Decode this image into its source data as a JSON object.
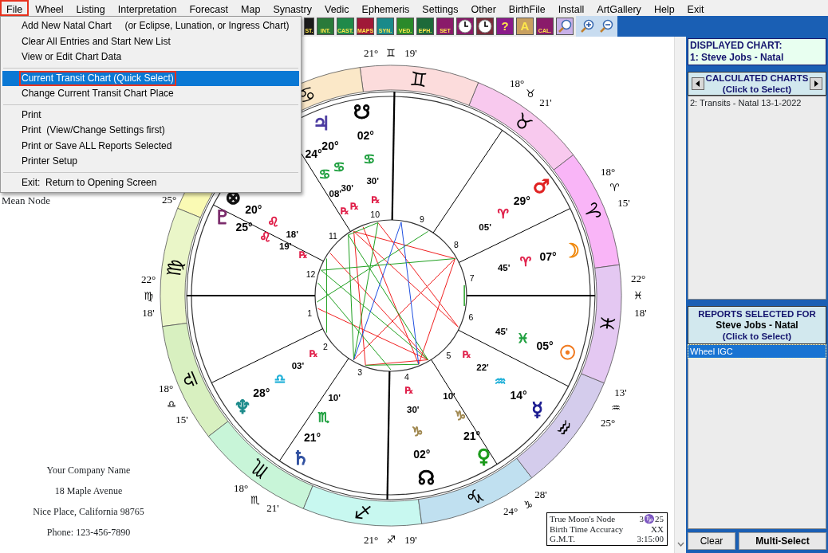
{
  "menu_bar": [
    {
      "label": "File",
      "outlined": true
    },
    {
      "label": "Wheel",
      "outlined": false
    },
    {
      "label": "Listing",
      "outlined": false
    },
    {
      "label": "Interpretation",
      "outlined": false
    },
    {
      "label": "Forecast",
      "outlined": false
    },
    {
      "label": "Map",
      "outlined": false
    },
    {
      "label": "Synastry",
      "outlined": false
    },
    {
      "label": "Vedic",
      "outlined": false
    },
    {
      "label": "Ephemeris",
      "outlined": false
    },
    {
      "label": "Settings",
      "outlined": false
    },
    {
      "label": "Other",
      "outlined": false
    },
    {
      "label": "BirthFile",
      "outlined": false
    },
    {
      "label": "Install",
      "outlined": false
    },
    {
      "label": "ArtGallery",
      "outlined": false
    },
    {
      "label": "Help",
      "outlined": false
    },
    {
      "label": "Exit",
      "outlined": false
    }
  ],
  "file_menu": [
    {
      "kind": "item",
      "label": "Add New Natal Chart     (or Eclipse, Lunation, or Ingress Chart)",
      "selected": false,
      "outlined": false
    },
    {
      "kind": "item",
      "label": "Clear All Entries and Start New List",
      "selected": false,
      "outlined": false
    },
    {
      "kind": "item",
      "label": "View or Edit Chart Data",
      "selected": false,
      "outlined": false
    },
    {
      "kind": "separator"
    },
    {
      "kind": "item",
      "label": "Current Transit Chart (Quick Select)",
      "selected": true,
      "outlined": true
    },
    {
      "kind": "item",
      "label": "Change Current Transit Chart Place",
      "selected": false,
      "outlined": false
    },
    {
      "kind": "separator"
    },
    {
      "kind": "item",
      "label": "Print",
      "selected": false,
      "outlined": false
    },
    {
      "kind": "item",
      "label": "Print  (View/Change Settings first)",
      "selected": false,
      "outlined": false
    },
    {
      "kind": "item",
      "label": "Print or Save ALL Reports Selected",
      "selected": false,
      "outlined": false
    },
    {
      "kind": "item",
      "label": "Printer Setup",
      "selected": false,
      "outlined": false
    },
    {
      "kind": "separator"
    },
    {
      "kind": "item",
      "label": "Exit:  Return to Opening Screen",
      "selected": false,
      "outlined": false
    }
  ],
  "toolbar": [
    {
      "kind": "labeled",
      "label": "ST.",
      "color": "#1a1a1a"
    },
    {
      "kind": "labeled",
      "label": "INT.",
      "color": "#2a7a3a"
    },
    {
      "kind": "labeled",
      "label": "CAST.",
      "color": "#1f8a4a"
    },
    {
      "kind": "labeled",
      "label": "MAPS",
      "color": "#a01838"
    },
    {
      "kind": "labeled",
      "label": "SYN.",
      "color": "#1a8a8a"
    },
    {
      "kind": "labeled",
      "label": "VED.",
      "color": "#2a8a2a"
    },
    {
      "kind": "labeled",
      "label": "EPH.",
      "color": "#1d6a3a"
    },
    {
      "kind": "labeled",
      "label": "SET",
      "color": "#8a1a6a"
    },
    {
      "kind": "clock",
      "color": "#8a1a6a"
    },
    {
      "kind": "clock",
      "color": "#7a2a3a"
    },
    {
      "kind": "help",
      "label": "?",
      "color": "#8a1a8a"
    },
    {
      "kind": "help",
      "label": "A",
      "color": "#c8a060"
    },
    {
      "kind": "labeled",
      "label": "CAL.",
      "color": "#8a1a6a"
    },
    {
      "kind": "magnifier",
      "color": "#c8b0e8"
    },
    {
      "kind": "zoom-in",
      "color": "#c8dcf0"
    },
    {
      "kind": "zoom-out",
      "color": "#c8dcf0"
    }
  ],
  "chart": {
    "side_label": "Mean Node",
    "zodiac_ring": [
      {
        "glyph": "♈",
        "color": "#f9b5f7"
      },
      {
        "glyph": "♉",
        "color": "#f8c9ee"
      },
      {
        "glyph": "♊",
        "color": "#fcdcdc"
      },
      {
        "glyph": "♋",
        "color": "#fbe8c8"
      },
      {
        "color": "#fafab4"
      },
      {
        "glyph": "♍",
        "color": "#eaf6c8"
      },
      {
        "glyph": "♎",
        "color": "#d8f0c0"
      },
      {
        "glyph": "♏",
        "color": "#c8f5d8"
      },
      {
        "glyph": "♐",
        "color": "#c8f8f0"
      },
      {
        "glyph": "♑",
        "color": "#c0e0f0"
      },
      {
        "glyph": "♒",
        "color": "#d4ccec"
      },
      {
        "glyph": "♓",
        "color": "#e4c8f2"
      }
    ],
    "cusps": [
      {
        "degree": "22°",
        "sign": "♍",
        "minutes": "18'"
      },
      {
        "degree": "18°",
        "sign": "♎",
        "minutes": "15'"
      },
      {
        "degree": "18°",
        "sign": "♏",
        "minutes": "21'"
      },
      {
        "degree": "21°",
        "sign": "♐",
        "minutes": "19'"
      },
      {
        "degree": "24°",
        "sign": "♑",
        "minutes": "28'"
      },
      {
        "degree": "25°",
        "sign": "♒",
        "minutes": "13'"
      },
      {
        "degree": "22°",
        "sign": "♓",
        "minutes": "18'"
      },
      {
        "degree": "18°",
        "sign": "♈",
        "minutes": "15'"
      },
      {
        "degree": "18°",
        "sign": "♉",
        "minutes": "21'"
      },
      {
        "degree": "21°",
        "sign": "♊",
        "minutes": "19'"
      },
      {
        "degree": "25°"
      }
    ],
    "house_numbers": [
      "1",
      "2",
      "3",
      "4",
      "5",
      "6",
      "7",
      "8",
      "9",
      "10",
      "11",
      "12"
    ],
    "planets": [
      {
        "glyph": "☋",
        "color": "#000000",
        "degree": "02°",
        "sign": {
          "glyph": "♋",
          "color": "#20a040"
        },
        "minutes": "30'",
        "retro_mark": "℞"
      },
      {
        "glyph": "♃",
        "color": "#4a3aa0",
        "degree": "20°",
        "sign": {
          "glyph": "♋",
          "color": "#20a040"
        },
        "minutes": "30'",
        "retro_mark": "℞"
      },
      {
        "degree": "24°",
        "sign": {
          "glyph": "♋",
          "color": "#20a040"
        },
        "minutes": "08'",
        "retro_mark": "℞"
      },
      {
        "glyph": "♂",
        "color": "#e02020",
        "degree": "29°",
        "sign": {
          "glyph": "♈",
          "color": "#e0204a"
        },
        "minutes": "05'"
      },
      {
        "glyph": "⊗",
        "color": "#101010",
        "degree": "20°",
        "sign": {
          "glyph": "♌",
          "color": "#e0204a"
        },
        "minutes": "18'"
      },
      {
        "glyph": "♇",
        "color": "#7a2a6a",
        "degree": "25°",
        "sign": {
          "glyph": "♌",
          "color": "#e0204a"
        },
        "minutes": "19'",
        "retro_mark": "℞"
      },
      {
        "glyph": "☽",
        "color": "#f08a10",
        "degree": "07°",
        "sign": {
          "glyph": "♈",
          "color": "#e0204a"
        },
        "minutes": "45'"
      },
      {
        "glyph": "☉",
        "color": "#f07a20",
        "degree": "05°",
        "sign": {
          "glyph": "♓",
          "color": "#20a040"
        },
        "minutes": "45'"
      },
      {
        "glyph": "♆",
        "color": "#1a8a8a",
        "degree": "28°",
        "sign": {
          "glyph": "♎",
          "color": "#20b0d8"
        },
        "minutes": "03'",
        "retro_mark": "℞"
      },
      {
        "glyph": "☿",
        "color": "#1a1a90",
        "degree": "14°",
        "sign": {
          "glyph": "♒",
          "color": "#20b0d8"
        },
        "minutes": "22'",
        "retro_mark": "℞"
      },
      {
        "glyph": "♄",
        "color": "#3050a0",
        "degree": "21°",
        "sign": {
          "glyph": "♏",
          "color": "#20a040"
        },
        "minutes": "10'"
      },
      {
        "glyph": "♀",
        "color": "#1a9a1a",
        "degree": "21°",
        "sign": {
          "glyph": "♑",
          "color": "#a08850"
        },
        "minutes": "10'"
      },
      {
        "glyph": "☊",
        "color": "#050505",
        "degree": "02°",
        "sign": {
          "glyph": "♑",
          "color": "#a08850"
        },
        "minutes": "30'",
        "retro_mark": "℞"
      }
    ],
    "company": [
      "Your Company Name",
      "18 Maple Avenue",
      "Nice Place, California 98765",
      "Phone: 123-456-7890"
    ],
    "info": [
      {
        "label": "True Moon's Node",
        "value": "3♑25"
      },
      {
        "label": "Birth Time Accuracy",
        "value": "XX"
      },
      {
        "label": "G.M.T.",
        "value": "3:15:00"
      }
    ]
  },
  "side_panel": {
    "displayed_title": "DISPLAYED CHART:",
    "displayed_name": "1: Steve Jobs - Natal",
    "calculated_title": "CALCULATED CHARTS",
    "calculated_hint": "(Click to Select)",
    "calculated_items": [
      {
        "label": "2: Transits - Natal 13-1-2022",
        "selected": false
      }
    ],
    "reports_title": "REPORTS SELECTED FOR",
    "reports_name": "Steve Jobs - Natal",
    "reports_hint": "(Click to Select)",
    "report_items": [
      {
        "label": "Wheel IGC",
        "selected": true
      }
    ],
    "buttons": [
      "Clear",
      "Multi-Select"
    ]
  }
}
